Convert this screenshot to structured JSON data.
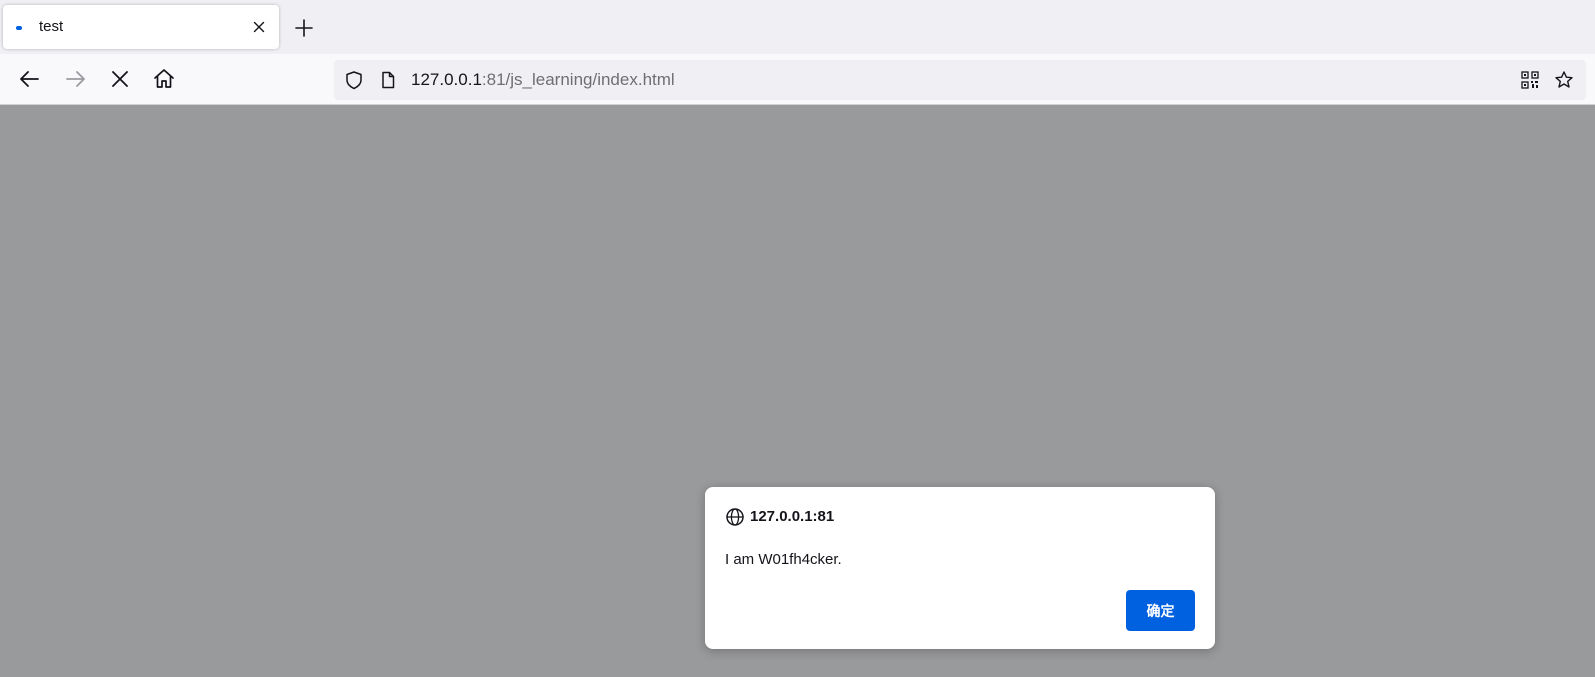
{
  "browser": {
    "tab": {
      "title": "test",
      "loading_indicator_color": "#0060df"
    },
    "icons": {
      "tab_close": "close-icon",
      "new_tab": "plus-icon",
      "back": "back-arrow-icon",
      "forward": "forward-arrow-icon",
      "stop": "stop-icon",
      "home": "home-icon",
      "tracking_protection": "shield-icon",
      "page_info": "page-icon",
      "qr_code": "qr-code-icon",
      "bookmark": "star-icon"
    },
    "url": {
      "host": "127.0.0.1",
      "rest": ":81/js_learning/index.html"
    }
  },
  "dialog": {
    "origin": "127.0.0.1:81",
    "message": "I am W01fh4cker.",
    "ok_label": "确定",
    "accent_color": "#0061e0"
  },
  "overlay_color": "#999a9c"
}
